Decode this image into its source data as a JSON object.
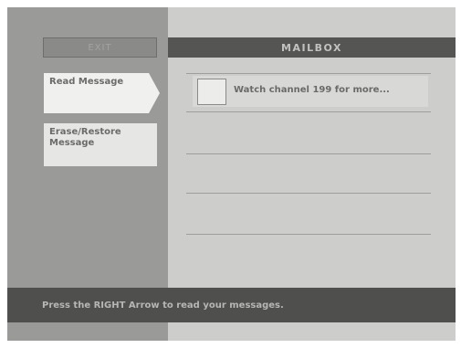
{
  "menu": {
    "exit_label": "EXIT",
    "items": [
      {
        "label": "Read Message",
        "selected": true
      },
      {
        "label": "Erase/Restore Message",
        "selected": false
      }
    ]
  },
  "mailbox": {
    "title": "MAILBOX",
    "messages": [
      {
        "subject": "Watch channel 199 for more...",
        "icon": "envelope-icon"
      }
    ]
  },
  "footer": {
    "instruction": "Press the RIGHT Arrow to read your messages."
  },
  "colors": {
    "left_panel": "#9a9a98",
    "right_panel": "#cdcdcb",
    "header_bar": "#555553",
    "footer_bar": "#4f4f4d",
    "selected_item": "#f0f0ee"
  }
}
